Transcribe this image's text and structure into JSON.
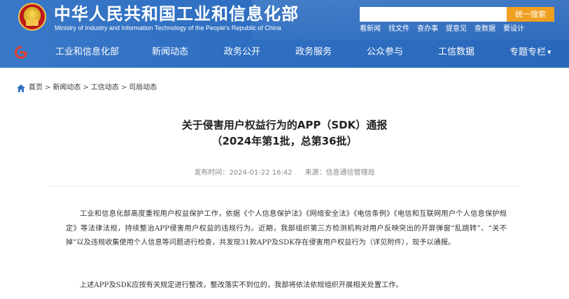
{
  "header": {
    "title": "中华人民共和国工业和信息化部",
    "subtitle": "Ministry of Industry and Information Technology of the People's Republic of China",
    "search": {
      "placeholder": "",
      "button_label": "统一搜索"
    },
    "quick_links": [
      "看新闻",
      "找文件",
      "查办事",
      "提意见",
      "查数据",
      "要设计"
    ],
    "nav": [
      {
        "label": "工业和信息化部",
        "dropdown": false
      },
      {
        "label": "新闻动态",
        "dropdown": false
      },
      {
        "label": "政务公开",
        "dropdown": false
      },
      {
        "label": "政务服务",
        "dropdown": false
      },
      {
        "label": "公众参与",
        "dropdown": false
      },
      {
        "label": "工信数据",
        "dropdown": false
      },
      {
        "label": "专题专栏",
        "dropdown": true
      }
    ],
    "colors": {
      "bar": "#2f6fc2",
      "search_button": "#f0a020"
    }
  },
  "breadcrumb": {
    "items": [
      "首页",
      "新闻动态",
      "工信动态",
      "司局动态"
    ],
    "separator": ">"
  },
  "article": {
    "title_line1": "关于侵害用户权益行为的APP（SDK）通报",
    "title_line2": "（2024年第1批，总第36批）",
    "publish_label": "发布时间：",
    "publish_time": "2024-01-22 16:42",
    "source_label": "来源：",
    "source": "信息通信管理局",
    "paragraphs": [
      "工业和信息化部高度重视用户权益保护工作，依据《个人信息保护法》《网络安全法》《电信条例》《电信和互联网用户个人信息保护规定》等法律法规，持续整治APP侵害用户权益的违规行为。近期，我部组织第三方检测机构对用户反映突出的开屏弹窗“乱跳转”、“关不掉”以及违规收集使用个人信息等问题进行检查，共发现31款APP及SDK存在侵害用户权益行为（详见附件），现予以通报。",
      "上述APP及SDK应按有关规定进行整改，整改落实不到位的，我部将依法依规组织开展相关处置工作。"
    ]
  }
}
